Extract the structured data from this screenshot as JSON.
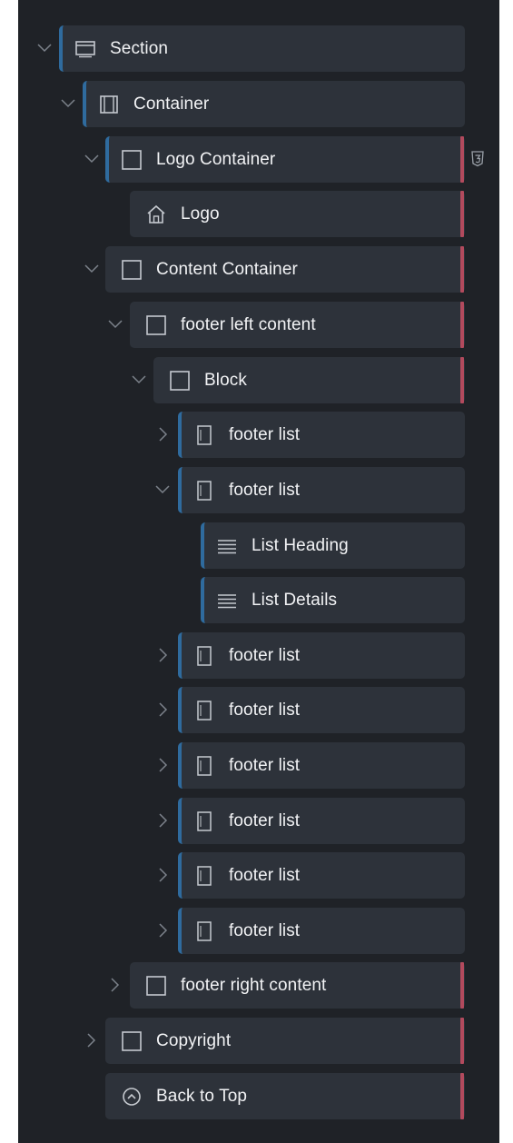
{
  "navigator": {
    "items": [
      {
        "label": "Section",
        "icon": "section-icon",
        "chevron": "down",
        "accent": "blue"
      },
      {
        "label": "Container",
        "icon": "container-icon",
        "chevron": "down",
        "accent": "blue"
      },
      {
        "label": "Logo Container",
        "icon": "div-block-icon",
        "chevron": "down",
        "accent": "blue",
        "badge": "css3-icon"
      },
      {
        "label": "Logo",
        "icon": "home-icon",
        "chevron": "none",
        "accent": "none"
      },
      {
        "label": "Content Container",
        "icon": "div-block-icon",
        "chevron": "down",
        "accent": "none"
      },
      {
        "label": "footer left content",
        "icon": "div-block-icon",
        "chevron": "down",
        "accent": "none"
      },
      {
        "label": "Block",
        "icon": "div-block-icon",
        "chevron": "down",
        "accent": "none"
      },
      {
        "label": "footer list",
        "icon": "list-block-icon",
        "chevron": "right",
        "accent": "blue"
      },
      {
        "label": "footer list",
        "icon": "list-block-icon",
        "chevron": "down",
        "accent": "blue"
      },
      {
        "label": "List Heading",
        "icon": "text-lines-icon",
        "chevron": "none",
        "accent": "blue"
      },
      {
        "label": "List Details",
        "icon": "text-lines-icon",
        "chevron": "none",
        "accent": "blue"
      },
      {
        "label": "footer list",
        "icon": "list-block-icon",
        "chevron": "right",
        "accent": "blue"
      },
      {
        "label": "footer list",
        "icon": "list-block-icon",
        "chevron": "right",
        "accent": "blue"
      },
      {
        "label": "footer list",
        "icon": "list-block-icon",
        "chevron": "right",
        "accent": "blue"
      },
      {
        "label": "footer list",
        "icon": "list-block-icon",
        "chevron": "right",
        "accent": "blue"
      },
      {
        "label": "footer list",
        "icon": "list-block-icon",
        "chevron": "right",
        "accent": "blue"
      },
      {
        "label": "footer list",
        "icon": "list-block-icon",
        "chevron": "right",
        "accent": "blue"
      },
      {
        "label": "footer right content",
        "icon": "div-block-icon",
        "chevron": "right",
        "accent": "none"
      },
      {
        "label": "Copyright",
        "icon": "div-block-icon",
        "chevron": "right",
        "accent": "none"
      },
      {
        "label": "Back to Top",
        "icon": "arrow-up-circle-icon",
        "chevron": "none",
        "accent": "none"
      }
    ]
  },
  "colors": {
    "panel": "#1f2227",
    "row": "#2d323a",
    "blue_accent": "#2f6b9e",
    "red_marker": "#b24a5d",
    "text": "#f2f3f5",
    "icon": "#c5c9cf"
  }
}
